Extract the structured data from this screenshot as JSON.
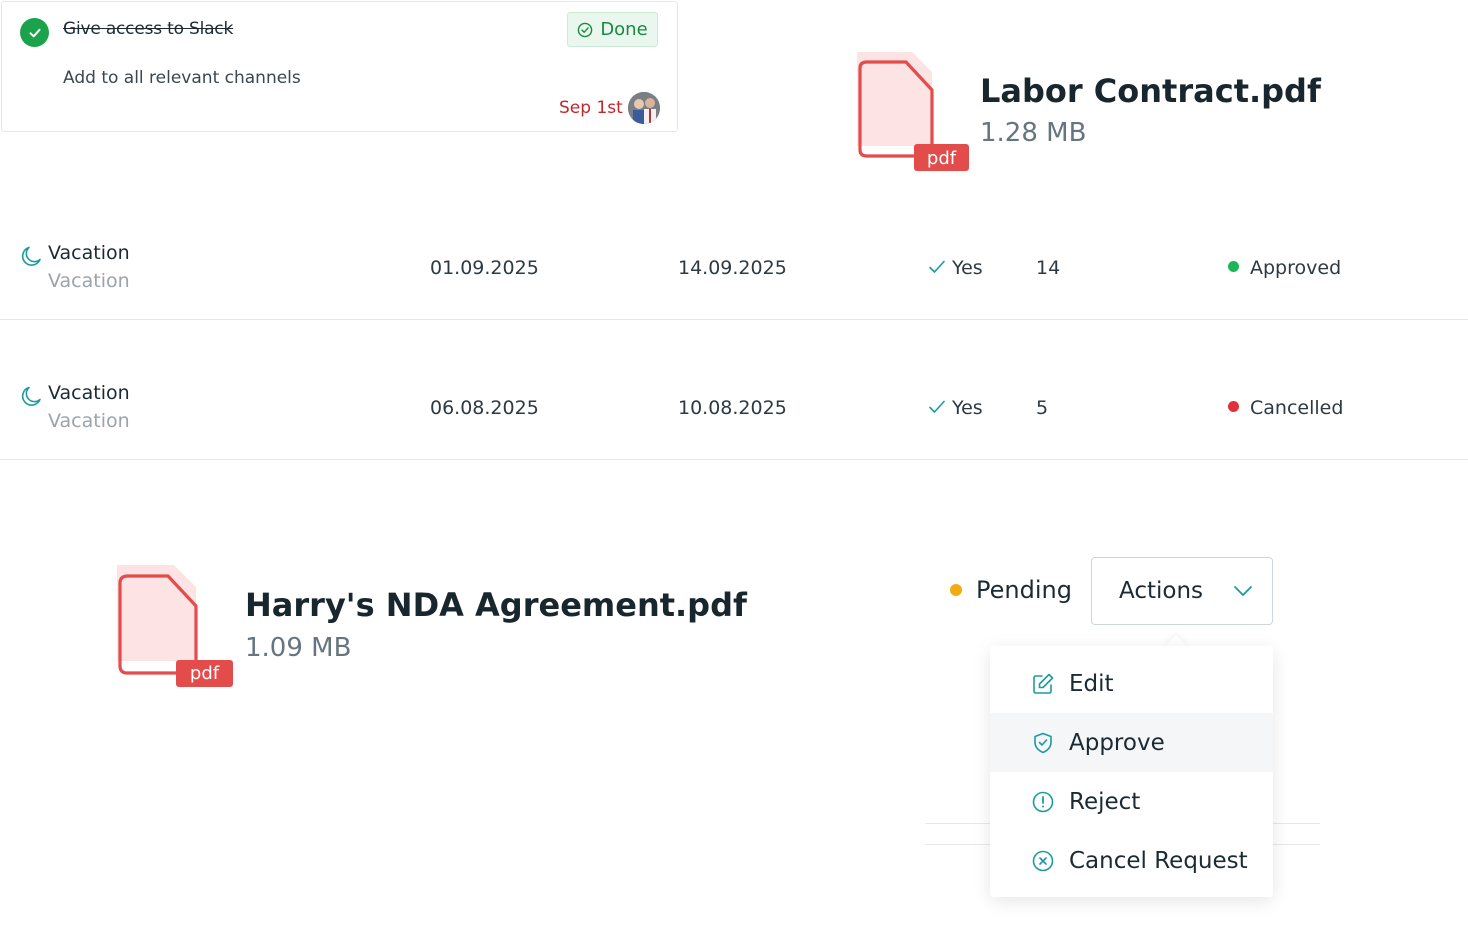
{
  "task": {
    "title": "Give access to Slack",
    "status_label": "Done",
    "description": "Add to all relevant channels",
    "due_date": "Sep 1st",
    "colors": {
      "check": "#1aa34a",
      "done_text": "#198a41",
      "due": "#c0282b"
    }
  },
  "files": [
    {
      "name": "Labor Contract.pdf",
      "size": "1.28 MB",
      "badge": "pdf"
    },
    {
      "name": "Harry's NDA Agreement.pdf",
      "size": "1.09 MB",
      "badge": "pdf"
    }
  ],
  "vacation_rows": [
    {
      "type": "Vacation",
      "subtype": "Vacation",
      "start": "01.09.2025",
      "end": "14.09.2025",
      "paid": "Yes",
      "days": "14",
      "status": "Approved",
      "status_color": "#1fb35a"
    },
    {
      "type": "Vacation",
      "subtype": "Vacation",
      "start": "06.08.2025",
      "end": "10.08.2025",
      "paid": "Yes",
      "days": "5",
      "status": "Cancelled",
      "status_color": "#e0313a"
    }
  ],
  "request": {
    "status": "Pending",
    "status_color": "#f0ad12",
    "actions_label": "Actions",
    "menu": [
      {
        "label": "Edit",
        "icon": "edit-icon"
      },
      {
        "label": "Approve",
        "icon": "shield-check-icon"
      },
      {
        "label": "Reject",
        "icon": "alert-circle-icon"
      },
      {
        "label": "Cancel Request",
        "icon": "x-circle-icon"
      }
    ]
  },
  "colors": {
    "teal_icon": "#1d9aa0",
    "pdf_red": "#e24c4b",
    "pdf_fill": "#fde3e3"
  }
}
